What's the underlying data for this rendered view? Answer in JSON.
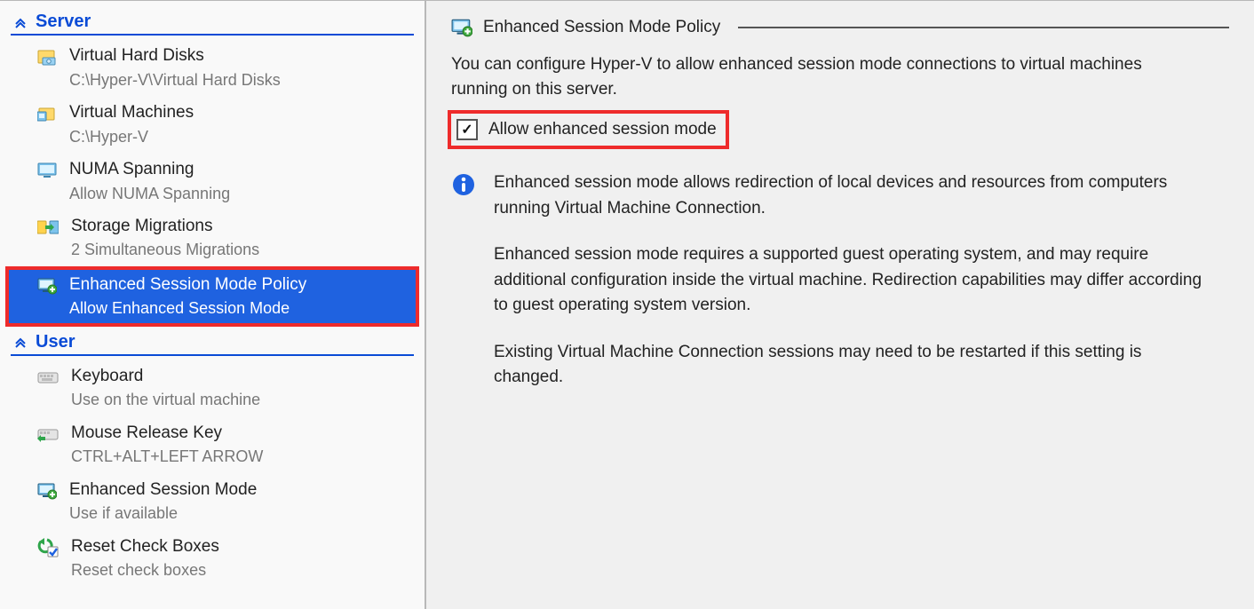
{
  "sidebar": {
    "sections": [
      {
        "title": "Server",
        "items": [
          {
            "id": "virtual-hard-disks",
            "label": "Virtual Hard Disks",
            "sub": "C:\\Hyper-V\\Virtual Hard Disks",
            "icon": "folder-disk-icon"
          },
          {
            "id": "virtual-machines",
            "label": "Virtual Machines",
            "sub": "C:\\Hyper-V",
            "icon": "folder-vm-icon"
          },
          {
            "id": "numa-spanning",
            "label": "NUMA Spanning",
            "sub": "Allow NUMA Spanning",
            "icon": "monitor-icon"
          },
          {
            "id": "storage-migrations",
            "label": "Storage Migrations",
            "sub": "2 Simultaneous Migrations",
            "icon": "storage-migration-icon"
          },
          {
            "id": "enhanced-session-mode-policy",
            "label": "Enhanced Session Mode Policy",
            "sub": "Allow Enhanced Session Mode",
            "icon": "monitor-plus-icon",
            "selected": true
          }
        ]
      },
      {
        "title": "User",
        "items": [
          {
            "id": "keyboard",
            "label": "Keyboard",
            "sub": "Use on the virtual machine",
            "icon": "keyboard-icon"
          },
          {
            "id": "mouse-release-key",
            "label": "Mouse Release Key",
            "sub": "CTRL+ALT+LEFT ARROW",
            "icon": "keyboard-arrow-icon"
          },
          {
            "id": "enhanced-session-mode",
            "label": "Enhanced Session Mode",
            "sub": "Use if available",
            "icon": "monitor-plus-icon"
          },
          {
            "id": "reset-check-boxes",
            "label": "Reset Check Boxes",
            "sub": "Reset check boxes",
            "icon": "reset-check-icon"
          }
        ]
      }
    ]
  },
  "detail": {
    "title": "Enhanced Session Mode Policy",
    "intro": "You can configure Hyper-V to allow enhanced session mode connections to virtual machines running on this server.",
    "checkbox_label": "Allow enhanced session mode",
    "checkbox_checked": "✓",
    "info1": "Enhanced session mode allows redirection of local devices and resources from computers running Virtual Machine Connection.",
    "info2": "Enhanced session mode requires a supported guest operating system, and may require additional configuration inside the virtual machine. Redirection capabilities may differ according to guest operating system version.",
    "info3": "Existing Virtual Machine Connection sessions may need to be restarted if this setting is changed."
  }
}
